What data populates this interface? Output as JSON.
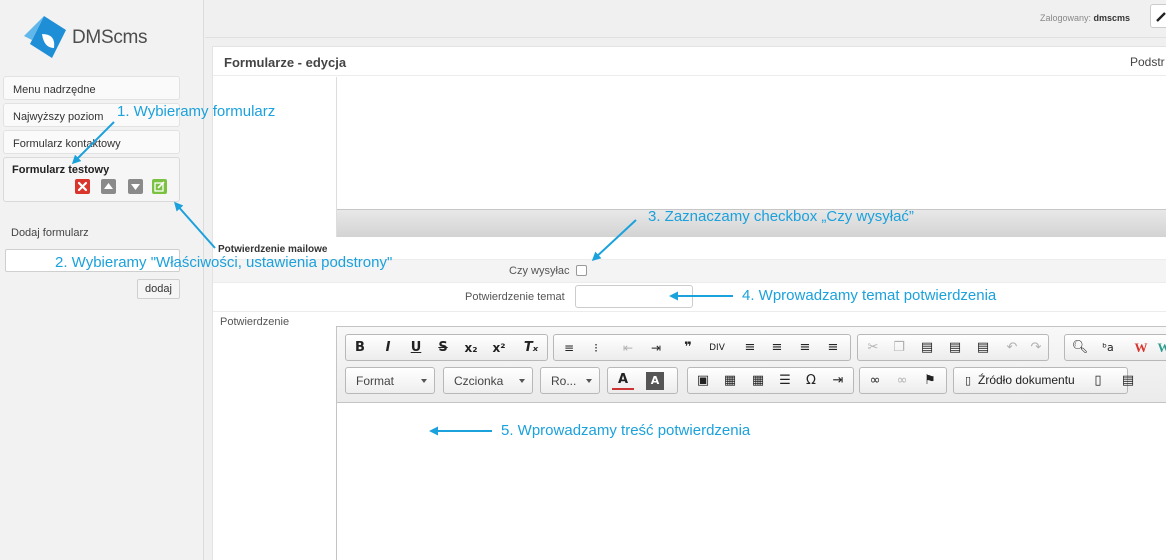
{
  "app": {
    "logo_text": "DMScms"
  },
  "header": {
    "login_label": "Zalogowany:",
    "login_user": "dmscms"
  },
  "sidebar": {
    "items": [
      {
        "label": "Menu nadrzędne"
      },
      {
        "label": "Najwyższy poziom"
      },
      {
        "label": "Formularz kontaktowy"
      }
    ],
    "active_item": {
      "label": "Formularz testowy"
    },
    "add_label": "Dodaj formularz",
    "add_input_value": "",
    "add_button": "dodaj"
  },
  "panel": {
    "title": "Formularze - edycja",
    "right_text": "Podstr"
  },
  "form": {
    "section_label": "Potwierdzenie mailowe",
    "send_checkbox_label": "Czy wysyłac",
    "send_checkbox_checked": false,
    "subject_label": "Potwierdzenie temat",
    "subject_value": "",
    "body_label": "Potwierdzenie"
  },
  "editor": {
    "format_label": "Format",
    "font_label": "Czcionka",
    "size_label": "Ro...",
    "source_label": "Źródło dokumentu"
  },
  "annotations": {
    "step1": "1. Wybieramy formularz",
    "step2": "2. Wybieramy \"Właściwości, ustawienia podstrony\"",
    "step3": "3. Zaznaczamy checkbox „Czy wysyłać”",
    "step4": "4. Wprowadzamy temat potwierdzenia",
    "step5": "5. Wprowadzamy treść potwierdzenia"
  },
  "colors": {
    "annotation": "#1ba1dc",
    "logo": "#1e8fd6",
    "delete_icon": "#d9352c",
    "edit_icon": "#7cc242",
    "gray_icon": "#8a8a8a"
  }
}
